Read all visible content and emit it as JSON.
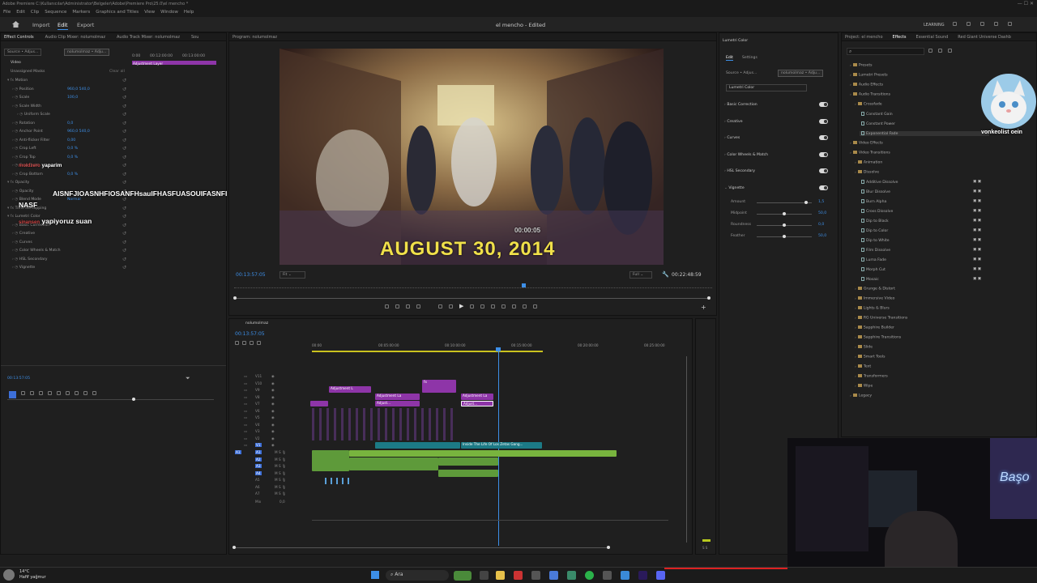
{
  "titlebar": {
    "path": "Adobe Premiere   C:\\Kullanıcılar\\Administrator\\Belgeler\\Adobe\\Premiere Pro\\25.0\\el mencho *"
  },
  "menu": [
    "File",
    "Edit",
    "Clip",
    "Sequence",
    "Markers",
    "Graphics and Titles",
    "View",
    "Window",
    "Help"
  ],
  "workspace": {
    "home": "home-icon",
    "tabs": [
      "Import",
      "Edit",
      "Export"
    ],
    "active": "Edit",
    "doc_title": "el mencho - Edited",
    "learning": "LEARNING"
  },
  "effect_controls": {
    "tabs": [
      "Effect Controls",
      "Audio Clip Mixer: nolumolmaz",
      "Audio Track Mixer: nolumolmaz",
      "Sou"
    ],
    "source_label": "Source • Adjus...",
    "seq_label": "nolumolmaz • Adju...",
    "ruler": [
      "0:00",
      "00:12:00:00",
      "00:13:00:00"
    ],
    "clip_label": "Adjustment Layer",
    "video_label": "Video",
    "masks_label": "Unassigned Masks",
    "clear_all": "Clear all",
    "props": [
      {
        "n": "Motion",
        "i": 0
      },
      {
        "n": "Position",
        "v": "960,0     540,0",
        "i": 1
      },
      {
        "n": "Scale",
        "v": "100,0",
        "i": 1
      },
      {
        "n": "Scale Width",
        "i": 1
      },
      {
        "n": "Uniform Scale",
        "i": 2
      },
      {
        "n": "Rotation",
        "v": "0,0",
        "i": 1
      },
      {
        "n": "Anchor Point",
        "v": "960,0     540,0",
        "i": 1
      },
      {
        "n": "Anti-flicker Filter",
        "v": "0,00",
        "i": 1
      },
      {
        "n": "Crop Left",
        "v": "0,0 %",
        "i": 1
      },
      {
        "n": "Crop Top",
        "v": "0,0 %",
        "i": 1
      },
      {
        "n": "Crop Right",
        "v": "",
        "i": 1
      },
      {
        "n": "Crop Bottom",
        "v": "0,0 %",
        "i": 1
      },
      {
        "n": "Opacity",
        "i": 0
      },
      {
        "n": "Opacity",
        "i": 1
      },
      {
        "n": "Blend Mode",
        "v": "Normal",
        "i": 1
      },
      {
        "n": "Time Remapping",
        "i": 0
      },
      {
        "n": "Lumetri Color",
        "i": 0
      },
      {
        "n": "Basic Correction",
        "i": 1
      },
      {
        "n": "Creative",
        "i": 1
      },
      {
        "n": "Curves",
        "i": 1
      },
      {
        "n": "Color Wheels & Match",
        "i": 1
      },
      {
        "n": "HSL Secondary",
        "i": 1
      },
      {
        "n": "Vignette",
        "i": 1
      }
    ],
    "timecode": "00:13:57:05",
    "chat": {
      "user1": "moldzero",
      "msg1": "yaparim",
      "msg2": "AISNFJIOASNHFIOSANFHsauIFHASFUASOUIFASNFI",
      "msg2b": "NASF",
      "user3": "sinansen",
      "msg3": "yapiyoruz suan"
    }
  },
  "program": {
    "title": "Program: nolumolmaz",
    "video_caption": "AUGUST 30, 2014",
    "video_timestamp": "00:00:05",
    "timecode": "00:13:57:05",
    "fit": "Fit",
    "full": "Full",
    "duration": "00:22:48:59"
  },
  "timeline": {
    "seq_name": "nolumolmaz",
    "timecode": "00:13:57:05",
    "ruler": [
      "00:00",
      "00:05:00:00",
      "00:10:00:00",
      "00:15:00:00",
      "00:20:00:00",
      "00:25:00:00"
    ],
    "vtracks": [
      "V11",
      "V10",
      "V9",
      "V8",
      "V7",
      "V6",
      "V5",
      "V4",
      "V3",
      "V2",
      "V1"
    ],
    "atracks": [
      "A1",
      "A2",
      "A3",
      "A4",
      "A5",
      "A6",
      "A7"
    ],
    "mix_label": "Mix",
    "mix_value": "0,0",
    "clip_adj": "Adjustment L",
    "clip_adj2": "Adjustment La",
    "clip_adj3": "Adjust...",
    "clip_adj4": "Adjustment La",
    "clip_fx": "fx",
    "clip_title": "Inside The Life Of Los Zetas Gang..."
  },
  "lumetri": {
    "title": "Lumetri Color",
    "tabs": [
      "Edit",
      "Settings"
    ],
    "source": "Source • Adjus...",
    "seq": "nolumolmaz • Adju...",
    "effect": "Lumetri Color",
    "sections": [
      "Basic Correction",
      "Creative",
      "Curves",
      "Color Wheels & Match",
      "HSL Secondary",
      "Vignette"
    ],
    "vignette": [
      {
        "n": "Amount",
        "v": "1,5",
        "f": 0.9
      },
      {
        "n": "Midpoint",
        "v": "50,0",
        "f": 0.5
      },
      {
        "n": "Roundness",
        "v": "0,0",
        "f": 0.5
      },
      {
        "n": "Feather",
        "v": "50,0",
        "f": 0.5
      }
    ]
  },
  "effects_panel": {
    "tabs": [
      "Project: el mencho",
      "Effects",
      "Essential Sound",
      "Red Giant Universe Dashb"
    ],
    "tree": [
      {
        "n": "Presets",
        "l": 1,
        "t": "f"
      },
      {
        "n": "Lumetri Presets",
        "l": 1,
        "t": "f"
      },
      {
        "n": "Audio Effects",
        "l": 1,
        "t": "f"
      },
      {
        "n": "Audio Transitions",
        "l": 1,
        "t": "f"
      },
      {
        "n": "Crossfade",
        "l": 2,
        "t": "f"
      },
      {
        "n": "Constant Gain",
        "l": 3,
        "t": "i"
      },
      {
        "n": "Constant Power",
        "l": 3,
        "t": "i"
      },
      {
        "n": "Exponential Fade",
        "l": 3,
        "t": "i"
      },
      {
        "n": "Video Effects",
        "l": 1,
        "t": "f"
      },
      {
        "n": "Video Transitions",
        "l": 1,
        "t": "f"
      },
      {
        "n": "Animation",
        "l": 2,
        "t": "f"
      },
      {
        "n": "Dissolve",
        "l": 2,
        "t": "f"
      },
      {
        "n": "Additive Dissolve",
        "l": 3,
        "t": "i"
      },
      {
        "n": "Blur Dissolve",
        "l": 3,
        "t": "i"
      },
      {
        "n": "Burn Alpha",
        "l": 3,
        "t": "i"
      },
      {
        "n": "Cross Dissolve",
        "l": 3,
        "t": "i"
      },
      {
        "n": "Dip to Black",
        "l": 3,
        "t": "i"
      },
      {
        "n": "Dip to Color",
        "l": 3,
        "t": "i"
      },
      {
        "n": "Dip to White",
        "l": 3,
        "t": "i"
      },
      {
        "n": "Film Dissolve",
        "l": 3,
        "t": "i"
      },
      {
        "n": "Luma Fade",
        "l": 3,
        "t": "i"
      },
      {
        "n": "Morph Cut",
        "l": 3,
        "t": "i"
      },
      {
        "n": "Mosaic",
        "l": 3,
        "t": "i"
      },
      {
        "n": "Grunge & Distort",
        "l": 2,
        "t": "f"
      },
      {
        "n": "Immersive Video",
        "l": 2,
        "t": "f"
      },
      {
        "n": "Lights & Blurs",
        "l": 2,
        "t": "f"
      },
      {
        "n": "RG Universe Transitions",
        "l": 2,
        "t": "f"
      },
      {
        "n": "Sapphire Builder",
        "l": 2,
        "t": "f"
      },
      {
        "n": "Sapphire Transitions",
        "l": 2,
        "t": "f"
      },
      {
        "n": "Slide",
        "l": 2,
        "t": "f"
      },
      {
        "n": "Smart Tools",
        "l": 2,
        "t": "f"
      },
      {
        "n": "Text",
        "l": 2,
        "t": "f"
      },
      {
        "n": "Transformers",
        "l": 2,
        "t": "f"
      },
      {
        "n": "Wipe",
        "l": 2,
        "t": "f"
      },
      {
        "n": "Legacy",
        "l": 1,
        "t": "f"
      }
    ]
  },
  "overlays": {
    "cat_caption": "vonkeolist oein",
    "neon": "Başo"
  },
  "taskbar": {
    "temp": "14°C",
    "weather": "Hafif yağmur",
    "search": "Ara"
  },
  "colors": {
    "accent": "#3d8fe8",
    "clip_purple": "#8e35a8",
    "clip_green": "#5e9a3a",
    "clip_teal": "#1c7a86",
    "caption_yellow": "#f0e04a"
  }
}
